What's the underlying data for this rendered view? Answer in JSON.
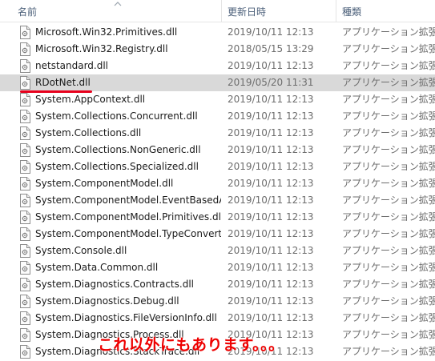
{
  "columns": {
    "name": "名前",
    "date": "更新日時",
    "type": "種類"
  },
  "files": [
    {
      "name": "Microsoft.Win32.Primitives.dll",
      "date": "2019/10/11 12:13",
      "type": "アプリケーション拡張"
    },
    {
      "name": "Microsoft.Win32.Registry.dll",
      "date": "2018/05/15 13:29",
      "type": "アプリケーション拡張"
    },
    {
      "name": "netstandard.dll",
      "date": "2019/10/11 12:13",
      "type": "アプリケーション拡張"
    },
    {
      "name": "RDotNet.dll",
      "date": "2019/05/20 11:31",
      "type": "アプリケーション拡張",
      "selected": true
    },
    {
      "name": "System.AppContext.dll",
      "date": "2019/10/11 12:13",
      "type": "アプリケーション拡張"
    },
    {
      "name": "System.Collections.Concurrent.dll",
      "date": "2019/10/11 12:13",
      "type": "アプリケーション拡張"
    },
    {
      "name": "System.Collections.dll",
      "date": "2019/10/11 12:13",
      "type": "アプリケーション拡張"
    },
    {
      "name": "System.Collections.NonGeneric.dll",
      "date": "2019/10/11 12:13",
      "type": "アプリケーション拡張"
    },
    {
      "name": "System.Collections.Specialized.dll",
      "date": "2019/10/11 12:13",
      "type": "アプリケーション拡張"
    },
    {
      "name": "System.ComponentModel.dll",
      "date": "2019/10/11 12:13",
      "type": "アプリケーション拡張"
    },
    {
      "name": "System.ComponentModel.EventBasedAs...",
      "date": "2019/10/11 12:13",
      "type": "アプリケーション拡張"
    },
    {
      "name": "System.ComponentModel.Primitives.dll",
      "date": "2019/10/11 12:13",
      "type": "アプリケーション拡張"
    },
    {
      "name": "System.ComponentModel.TypeConverter....",
      "date": "2019/10/11 12:13",
      "type": "アプリケーション拡張"
    },
    {
      "name": "System.Console.dll",
      "date": "2019/10/11 12:13",
      "type": "アプリケーション拡張"
    },
    {
      "name": "System.Data.Common.dll",
      "date": "2019/10/11 12:13",
      "type": "アプリケーション拡張"
    },
    {
      "name": "System.Diagnostics.Contracts.dll",
      "date": "2019/10/11 12:13",
      "type": "アプリケーション拡張"
    },
    {
      "name": "System.Diagnostics.Debug.dll",
      "date": "2019/10/11 12:13",
      "type": "アプリケーション拡張"
    },
    {
      "name": "System.Diagnostics.FileVersionInfo.dll",
      "date": "2019/10/11 12:13",
      "type": "アプリケーション拡張"
    },
    {
      "name": "System.Diagnostics.Process.dll",
      "date": "2019/10/11 12:13",
      "type": "アプリケーション拡張"
    },
    {
      "name": "System.Diagnostics.StackTrace.dll",
      "date": "2019/10/11 12:13",
      "type": "アプリケーション拡張"
    }
  ],
  "annotation": "これ以外にもあります。。。",
  "icons": {
    "file": "dll-file-icon",
    "sort": "sort-up-icon"
  },
  "colors": {
    "selected_row": "#d9d9d9",
    "annotation": "#ee0000",
    "underline": "#e8001c"
  }
}
